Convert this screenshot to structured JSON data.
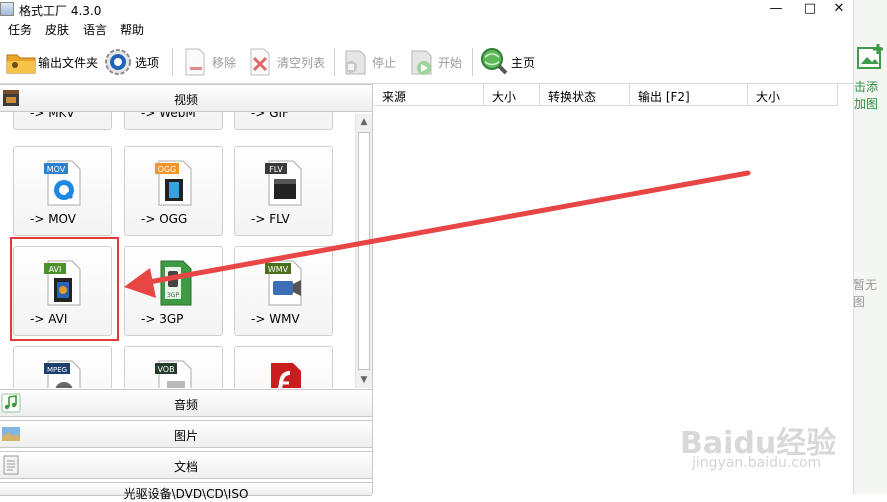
{
  "window": {
    "title": "格式工厂 4.3.0"
  },
  "menu": [
    "任务",
    "皮肤",
    "语言",
    "帮助"
  ],
  "toolbar": {
    "output_folder": "输出文件夹",
    "options": "选项",
    "remove": "移除",
    "clear_list": "清空列表",
    "stop": "停止",
    "start": "开始",
    "home": "主页"
  },
  "categories": {
    "video": "视频",
    "audio": "音频",
    "image": "图片",
    "document": "文档",
    "rom": "光驱设备\\DVD\\CD\\ISO"
  },
  "tiles": [
    {
      "label": "-> MKV",
      "badge": ""
    },
    {
      "label": "-> WebM",
      "badge": ""
    },
    {
      "label": "-> GIF",
      "badge": ""
    },
    {
      "label": "-> MOV",
      "badge": "MOV"
    },
    {
      "label": "-> OGG",
      "badge": "OGG"
    },
    {
      "label": "-> FLV",
      "badge": "FLV"
    },
    {
      "label": "-> AVI",
      "badge": "AVI"
    },
    {
      "label": "-> 3GP",
      "badge": "3GP"
    },
    {
      "label": "-> WMV",
      "badge": "WMV"
    },
    {
      "label": "",
      "badge": "MPEG"
    },
    {
      "label": "",
      "badge": "VOB"
    },
    {
      "label": "",
      "badge": ""
    }
  ],
  "list_headers": [
    "来源",
    "大小",
    "转换状态",
    "输出 [F2]",
    "大小"
  ],
  "side": {
    "add": "击添加图",
    "empty": "暂无图"
  },
  "watermark": {
    "brand": "Baidu经验",
    "url": "jingyan.baidu.com"
  },
  "colors": {
    "highlight": "#e23b3b",
    "arrow": "#e84545"
  }
}
